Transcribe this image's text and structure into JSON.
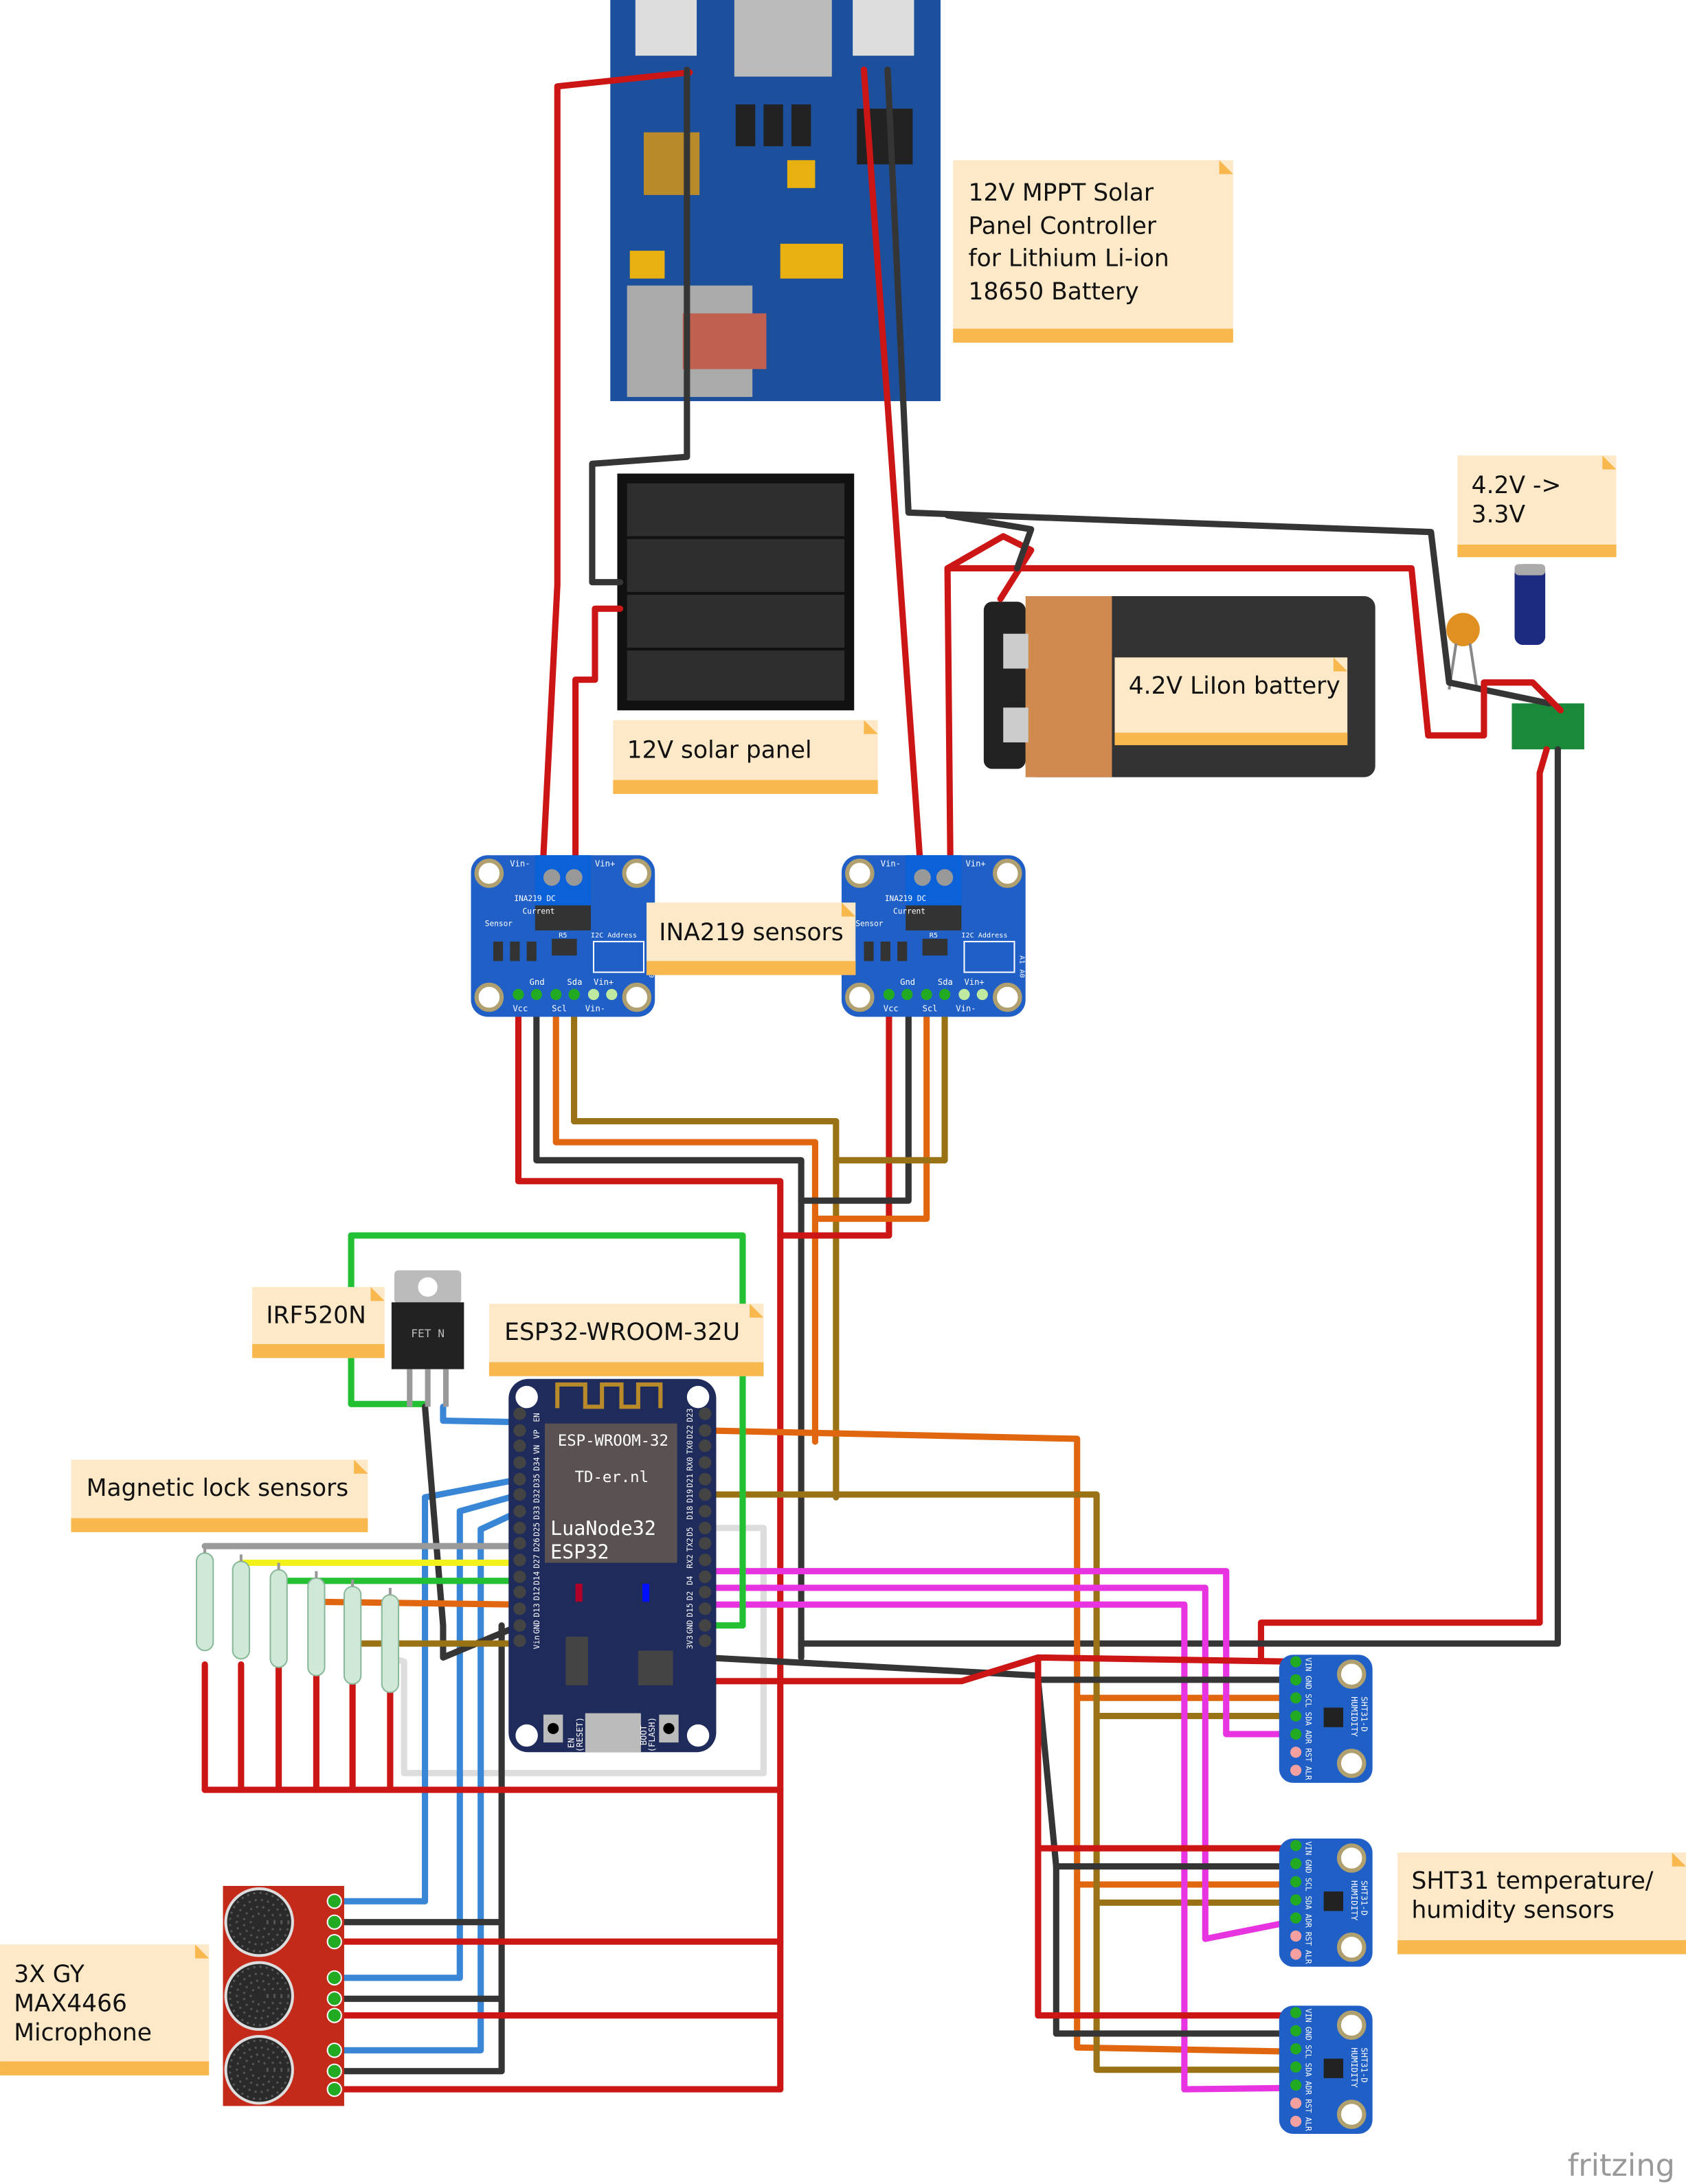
{
  "notes": {
    "controller": [
      "12V MPPT Solar",
      "Panel Controller",
      "for Lithium Li-ion",
      "18650 Battery"
    ],
    "solar_panel": "12V solar panel",
    "battery": "4.2V LiIon battery",
    "regulator": [
      "4.2V ->",
      "3.3V"
    ],
    "ina219": "INA219 sensors",
    "irf520n": "IRF520N",
    "esp32": "ESP32-WROOM-32U",
    "magnetic_lock": "Magnetic lock sensors",
    "microphone": [
      "3X GY",
      "MAX4466",
      "Microphone"
    ],
    "sht31": [
      "SHT31 temperature/",
      "humidity sensors"
    ]
  },
  "esp32": {
    "module": "ESP-WROOM-32",
    "vendor": "TD-er.nl",
    "name1": "LuaNode32",
    "name2": "ESP32",
    "left_pins": [
      "EN",
      "VP",
      "VN",
      "D34",
      "D35",
      "D32",
      "D33",
      "D25",
      "D26",
      "D27",
      "D14",
      "D12",
      "D13",
      "GND",
      "Vin"
    ],
    "right_pins": [
      "D23",
      "D22",
      "TX0",
      "RX0",
      "D21",
      "D19",
      "D18",
      "D5",
      "TX2",
      "RX2",
      "D4",
      "D2",
      "D15",
      "GND",
      "3V3"
    ],
    "en_button": [
      "EN",
      "(RESET)"
    ],
    "boot_button": [
      "BOOT",
      "(FLASH)"
    ]
  },
  "ina219": {
    "vin_minus": "Vin-",
    "vin_plus": "Vin+",
    "title": [
      "INA219 DC",
      "Current",
      "Sensor"
    ],
    "r5": "R5",
    "i2c": "I2C Address",
    "a1": "A1",
    "a0": "A0",
    "bottom_top": [
      "Gnd",
      "Sda",
      "Vin+"
    ],
    "bottom_bottom": [
      "Vcc",
      "Scl",
      "Vin-"
    ]
  },
  "sht31": {
    "title": [
      "SHT31-D",
      "HUMIDITY"
    ],
    "pins": [
      "VIN",
      "GND",
      "SCL",
      "SDA",
      "ADR",
      "RST",
      "ALR"
    ]
  },
  "irf520n": {
    "marking": "FET N"
  },
  "logo": "fritzing",
  "colors": {
    "wire_red": "#cc1616",
    "wire_black": "#353535",
    "wire_orange": "#e0660f",
    "wire_brown": "#9a7216",
    "wire_blue": "#3a86d6",
    "wire_green": "#22c032",
    "wire_magenta": "#e834e0",
    "wire_yellow": "#f2f21a",
    "wire_grey": "#9a9a9a",
    "wire_white": "#dddddd",
    "note_bg": "#fde8c8",
    "note_band": "#f8b84e",
    "pcb_blue": "#1f5fc6",
    "esp_navy": "#1f2b5a",
    "mic_red": "#c42a1a"
  }
}
